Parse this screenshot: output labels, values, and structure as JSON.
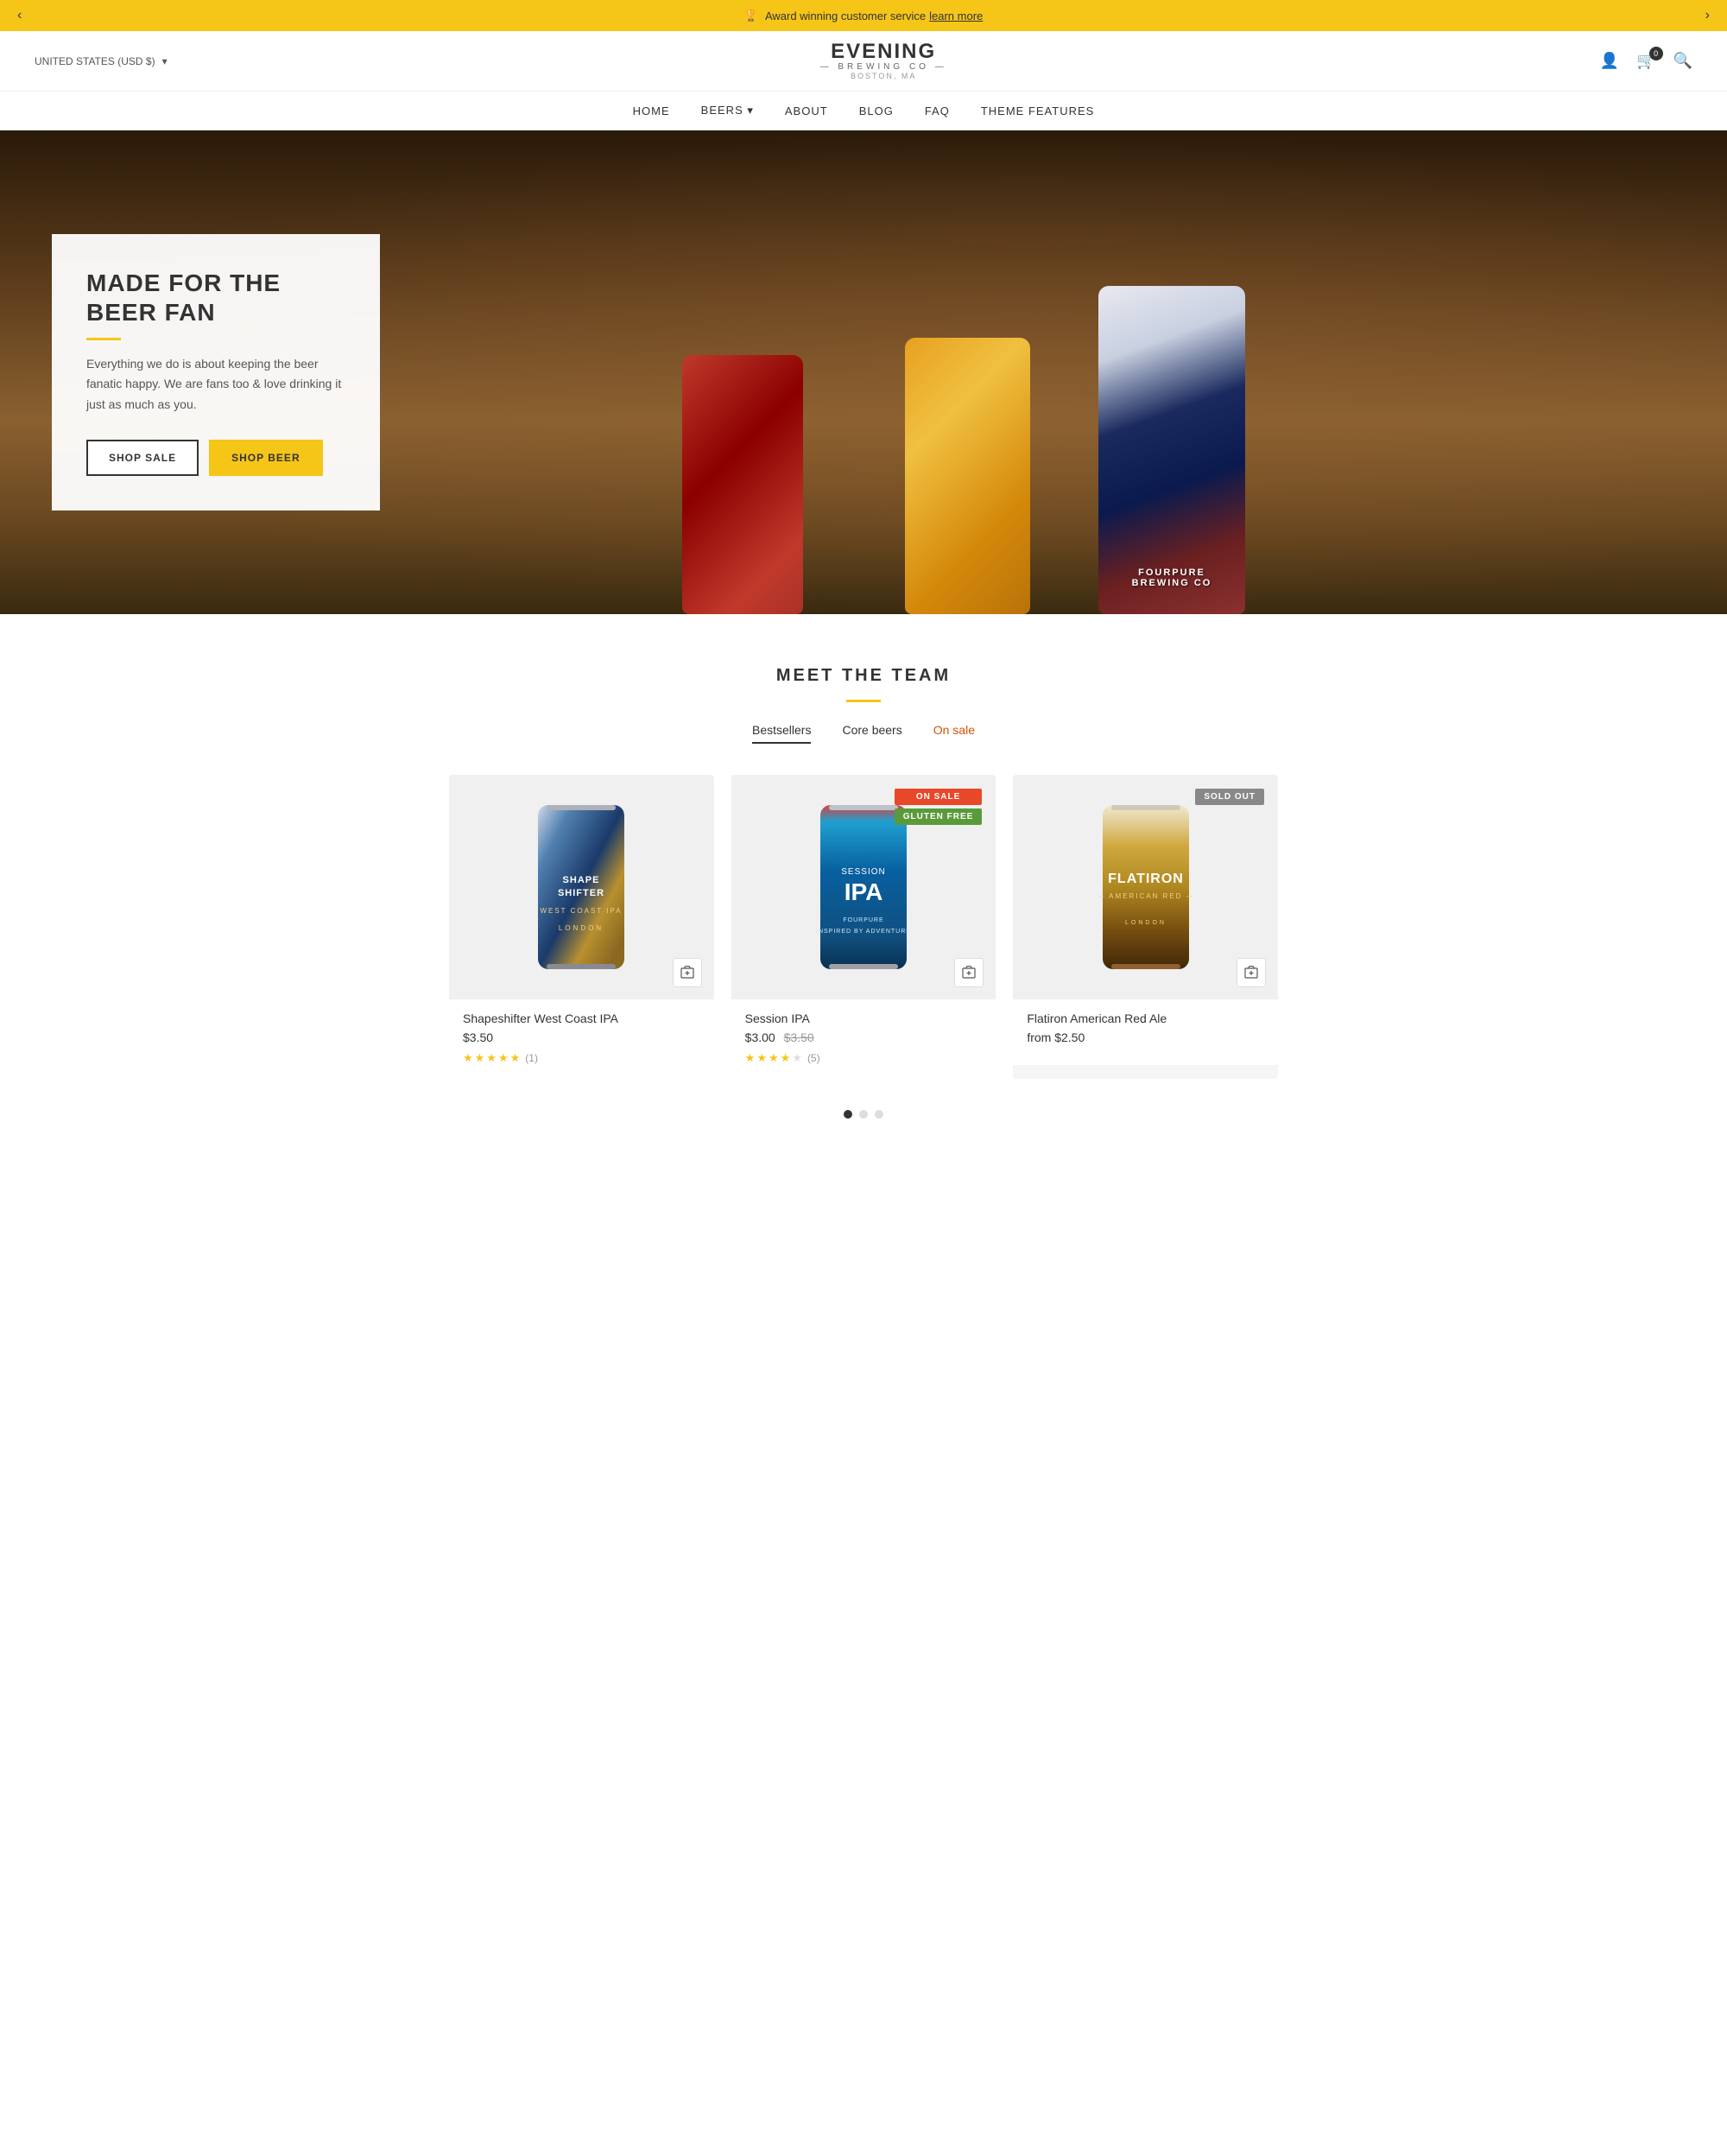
{
  "announcement": {
    "text": "Award winning customer service",
    "link_text": "learn more",
    "prev_label": "‹",
    "next_label": "›",
    "trophy": "🏆"
  },
  "header": {
    "region": "UNITED STATES (USD $)",
    "logo_top": "EVENING",
    "logo_sub": "— BREWING CO —",
    "logo_tagline": "BOSTON, MA",
    "cart_count": "0",
    "icons": {
      "user": "👤",
      "cart": "🛒",
      "search": "🔍"
    }
  },
  "nav": {
    "items": [
      {
        "label": "HOME",
        "has_dropdown": false
      },
      {
        "label": "BEERS",
        "has_dropdown": true
      },
      {
        "label": "ABOUT",
        "has_dropdown": false
      },
      {
        "label": "BLOG",
        "has_dropdown": false
      },
      {
        "label": "FAQ",
        "has_dropdown": false
      },
      {
        "label": "THEME FEATURES",
        "has_dropdown": false
      }
    ]
  },
  "hero": {
    "title": "MADE FOR THE BEER FAN",
    "accent_color": "#f5c518",
    "description": "Everything we do is about keeping the beer fanatic happy. We are fans too & love drinking it just as much as you.",
    "btn_sale": "SHOP SALE",
    "btn_beer": "SHOP BEER",
    "can_label_right": "FOURPURE\nBREWING CO"
  },
  "products": {
    "section_title": "MEET THE TEAM",
    "tabs": [
      {
        "label": "Bestsellers",
        "active": true
      },
      {
        "label": "Core beers",
        "active": false
      },
      {
        "label": "On sale",
        "active": false,
        "is_sale": true
      }
    ],
    "items": [
      {
        "name": "Shapeshifter West Coast IPA",
        "price": "$3.50",
        "original_price": null,
        "from": false,
        "badges": [],
        "rating": 5,
        "review_count": 1,
        "sold_out": false,
        "on_sale": false,
        "can_style": "shape-shifter"
      },
      {
        "name": "Session IPA",
        "price": "$3.00",
        "original_price": "$3.50",
        "from": false,
        "badges": [
          "ON SALE",
          "GLUTEN FREE"
        ],
        "rating": 4,
        "review_count": 5,
        "sold_out": false,
        "on_sale": true,
        "can_style": "session-ipa"
      },
      {
        "name": "Flatiron American Red Ale",
        "price": "$2.50",
        "original_price": null,
        "from": true,
        "badges": [
          "SOLD OUT"
        ],
        "rating": 0,
        "review_count": 0,
        "sold_out": true,
        "on_sale": false,
        "can_style": "flatiron"
      }
    ],
    "pagination_dots": 3,
    "active_dot": 0,
    "badge_sale_label": "On SALE",
    "badge_sold_label": "SOLD OUT",
    "badge_gluten_label": "GLUTEN FREE"
  }
}
